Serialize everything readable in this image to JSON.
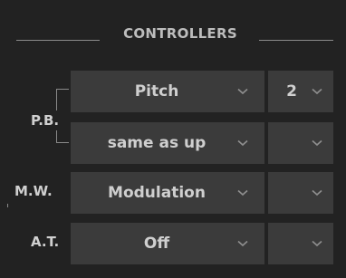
{
  "section": {
    "title": "CONTROLLERS"
  },
  "rows": {
    "pitch_bend": {
      "label": "P.B.",
      "up": {
        "source": "Pitch",
        "channel": "2"
      },
      "down": {
        "source": "same as up",
        "channel": ""
      }
    },
    "mod_wheel": {
      "label": "M.W.",
      "source": "Modulation",
      "channel": ""
    },
    "aftertouch": {
      "label": "A.T.",
      "source": "Off",
      "channel": ""
    }
  },
  "icons": {
    "dropdown": "chevron-down-icon"
  },
  "colors": {
    "background": "#222222",
    "dropdown_bg": "#3b3b3b",
    "text": "#cfcfcf",
    "chevron": "#8f8f8f"
  }
}
